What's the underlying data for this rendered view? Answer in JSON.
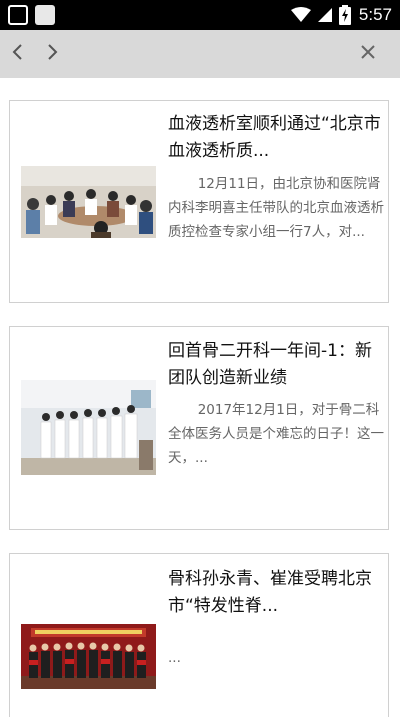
{
  "status_bar": {
    "time": "5:57",
    "icons": [
      "app-icon",
      "app-icon",
      "wifi-icon",
      "signal-icon",
      "battery-charging-icon"
    ]
  },
  "nav_bar": {
    "back_icon": "chevron-left-icon",
    "forward_icon": "chevron-right-icon",
    "close_icon": "close-icon"
  },
  "articles": [
    {
      "title": "血液透析室顺利通过“北京市血液透析质...",
      "summary": "12月11日，由北京协和医院肾内科李明喜主任带队的北京血液透析质控检查专家小组一行7人，对...",
      "image": "meeting-room-photo"
    },
    {
      "title": "回首骨二开科一年间-1：新团队创造新业绩",
      "summary": "2017年12月1日，对于骨二科全体医务人员是个难忘的日子！这一天，...",
      "image": "medical-team-photo"
    },
    {
      "title": "骨科孙永青、崔准受聘北京市“特发性脊...",
      "summary": "...",
      "image": "ceremony-group-photo"
    }
  ],
  "colors": {
    "status_bar": "#000000",
    "nav_bar": "#d9d9d9",
    "card_border": "#d0d0d0",
    "title_text": "#111111",
    "summary_text": "#666666"
  }
}
